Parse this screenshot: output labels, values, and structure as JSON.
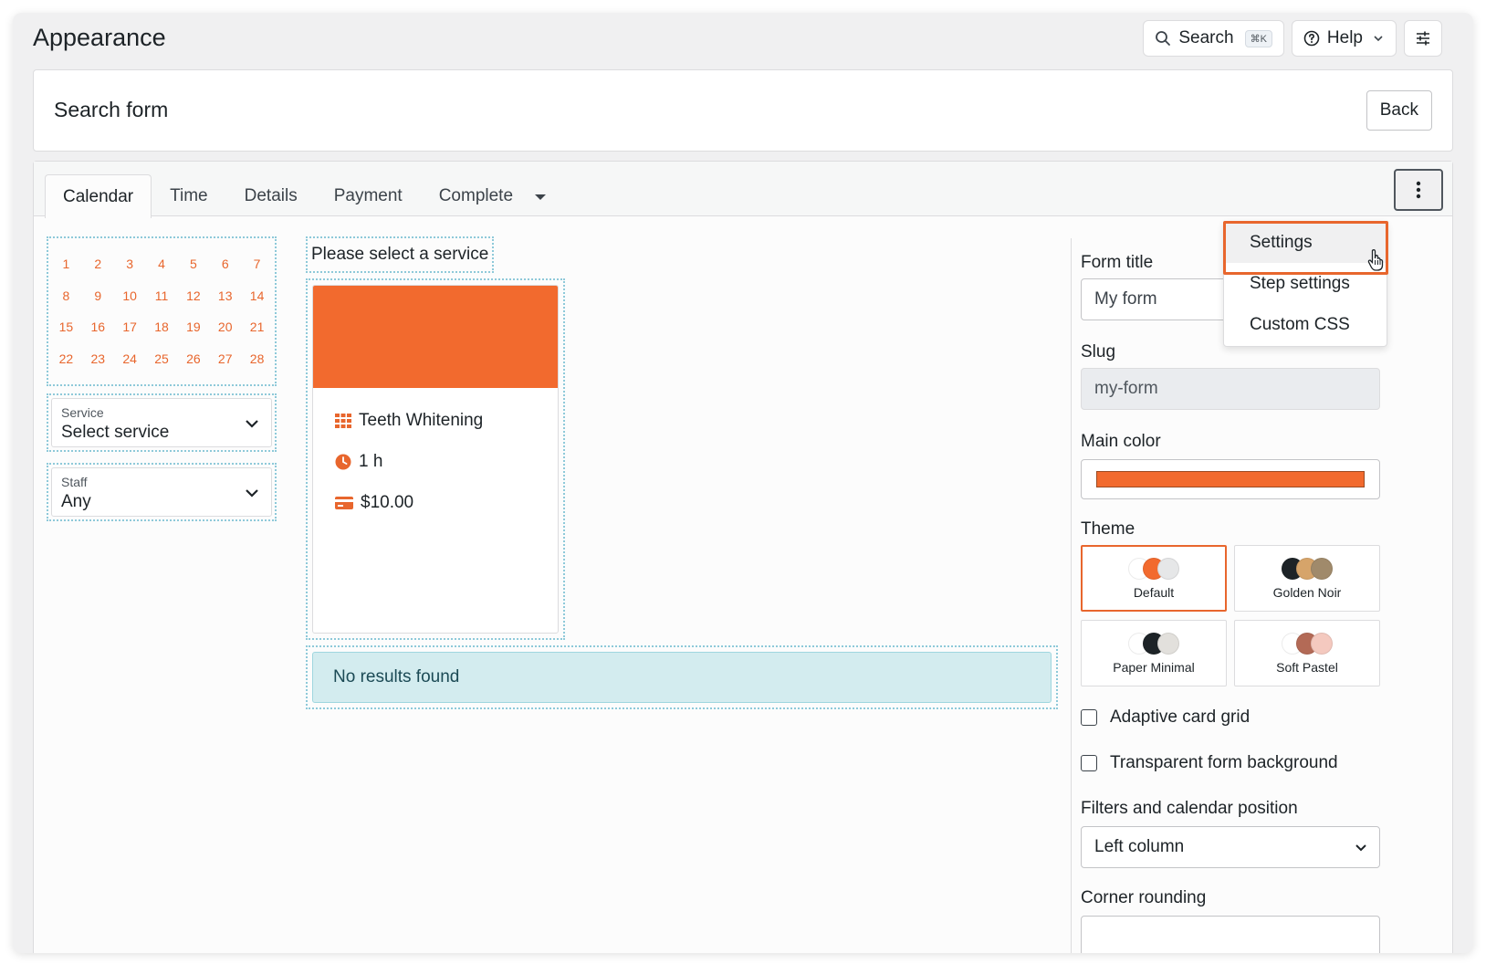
{
  "header": {
    "title": "Appearance",
    "search_label": "Search",
    "search_shortcut": "⌘K",
    "help_label": "Help"
  },
  "form_header": {
    "title": "Search form",
    "back_label": "Back"
  },
  "tabs": [
    {
      "label": "Calendar",
      "active": true
    },
    {
      "label": "Time",
      "active": false
    },
    {
      "label": "Details",
      "active": false
    },
    {
      "label": "Payment",
      "active": false
    },
    {
      "label": "Complete",
      "active": false
    }
  ],
  "calendar": {
    "days": [
      "1",
      "2",
      "3",
      "4",
      "5",
      "6",
      "7",
      "8",
      "9",
      "10",
      "11",
      "12",
      "13",
      "14",
      "15",
      "16",
      "17",
      "18",
      "19",
      "20",
      "21",
      "22",
      "23",
      "24",
      "25",
      "26",
      "27",
      "28"
    ]
  },
  "filters": {
    "service": {
      "label": "Service",
      "value": "Select service"
    },
    "staff": {
      "label": "Staff",
      "value": "Any"
    }
  },
  "services": {
    "prompt": "Please select a service",
    "card": {
      "name": "Teeth Whitening",
      "duration": "1 h",
      "price": "$10.00"
    },
    "no_results": "No results found"
  },
  "settings": {
    "form_title_label": "Form title",
    "form_title_value": "My form",
    "slug_label": "Slug",
    "slug_value": "my-form",
    "main_color_label": "Main color",
    "main_color": "#f26a2e",
    "theme_label": "Theme",
    "themes": [
      {
        "name": "Default",
        "selected": true,
        "colors": [
          "#ffffff",
          "#f26a2e",
          "#e6e7e8"
        ]
      },
      {
        "name": "Golden Noir",
        "selected": false,
        "colors": [
          "#1d2327",
          "#d6a46a",
          "#a08a6b"
        ]
      },
      {
        "name": "Paper Minimal",
        "selected": false,
        "colors": [
          "#ffffff",
          "#1d2327",
          "#e2e0dc"
        ]
      },
      {
        "name": "Soft Pastel",
        "selected": false,
        "colors": [
          "#ffffff",
          "#b36a56",
          "#f4c9bf"
        ]
      }
    ],
    "adaptive_grid_label": "Adaptive card grid",
    "adaptive_grid_checked": false,
    "transparent_bg_label": "Transparent form background",
    "transparent_bg_checked": false,
    "position_label": "Filters and calendar position",
    "position_value": "Left column",
    "corner_label": "Corner rounding"
  },
  "menu": {
    "items": [
      "Settings",
      "Step settings",
      "Custom CSS"
    ]
  },
  "colors": {
    "accent": "#e8662d",
    "info_bg": "#d3ecef"
  }
}
